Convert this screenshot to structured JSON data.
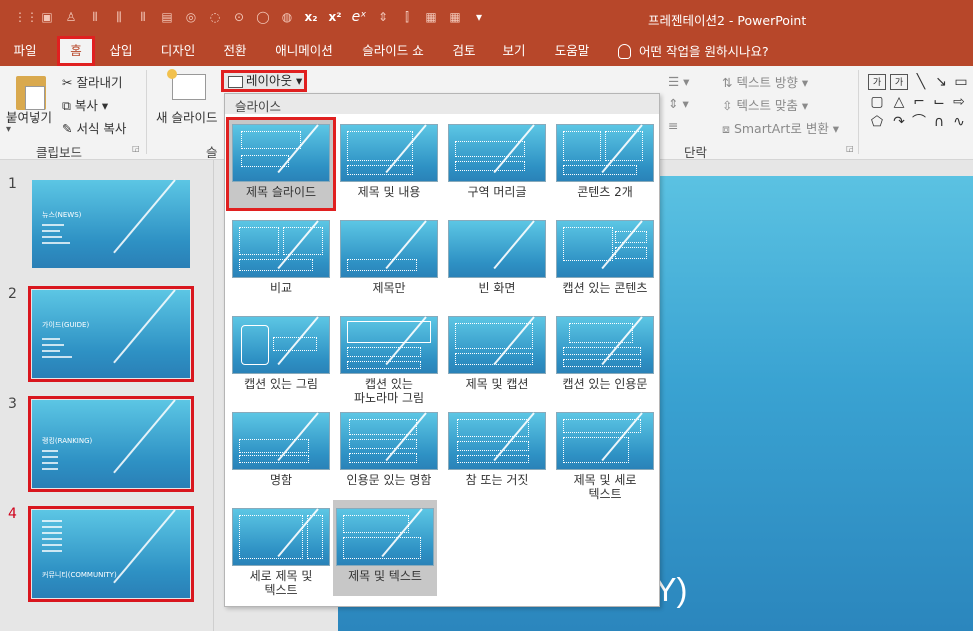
{
  "window": {
    "title": "프레젠테이션2  -  PowerPoint"
  },
  "qat_icons": [
    "grid-icon",
    "save-icon",
    "format-icon",
    "align-icon",
    "align-center-icon",
    "align-right-icon",
    "text-icon",
    "circle-icon",
    "curve-icon",
    "dots-icon",
    "oval-icon",
    "brush-icon",
    "subscript-icon",
    "superscript-icon",
    "equation-icon",
    "spacing-icon",
    "columns-icon",
    "table-icon",
    "table2-icon",
    "more-icon"
  ],
  "tabs": [
    "파일",
    "홈",
    "삽입",
    "디자인",
    "전환",
    "애니메이션",
    "슬라이드 쇼",
    "검토",
    "보기",
    "도움말"
  ],
  "tellme": "어떤 작업을 원하시나요?",
  "ribbon": {
    "paste": "붙여넣기",
    "cut": "잘라내기",
    "copy": "복사",
    "format_painter": "서식 복사",
    "clipboard_group": "클립보드",
    "new_slide": "새 슬라이드",
    "slide_group_partial": "슬",
    "layout": "레이아웃",
    "text_direction": "텍스트 방향",
    "align_text": "텍스트 맞춤",
    "smartart": "SmartArt로 변환",
    "paragraph_group": "단락"
  },
  "slides": [
    {
      "num": "1",
      "title": "뉴스(NEWS)",
      "framed": false
    },
    {
      "num": "2",
      "title": "가이드(GUIDE)",
      "framed": true
    },
    {
      "num": "3",
      "title": "랭킹(RANKING)",
      "framed": true
    },
    {
      "num": "4",
      "title": "커뮤니티(COMMUNITY)",
      "framed": true
    }
  ],
  "main_slide": {
    "title_fragment": "MUNITY)"
  },
  "layout_menu": {
    "header": "슬라이스",
    "items": [
      "제목 슬라이드",
      "제목 및 내용",
      "구역 머리글",
      "콘텐츠 2개",
      "비교",
      "제목만",
      "빈 화면",
      "캡션 있는 콘텐츠",
      "캡션 있는 그림",
      "캡션 있는\n파노라마 그림",
      "제목 및 캡션",
      "캡션 있는 인용문",
      "명함",
      "인용문 있는 명함",
      "참 또는 거짓",
      "제목 및 세로\n텍스트",
      "세로 제목 및\n텍스트",
      "제목 및 텍스트"
    ],
    "selected_index": 0,
    "highlight_index": 17
  },
  "colors": {
    "accent": "#b7472a",
    "highlight": "#e02020",
    "slide_top": "#5cc6e4",
    "slide_bottom": "#2a7fb6"
  }
}
